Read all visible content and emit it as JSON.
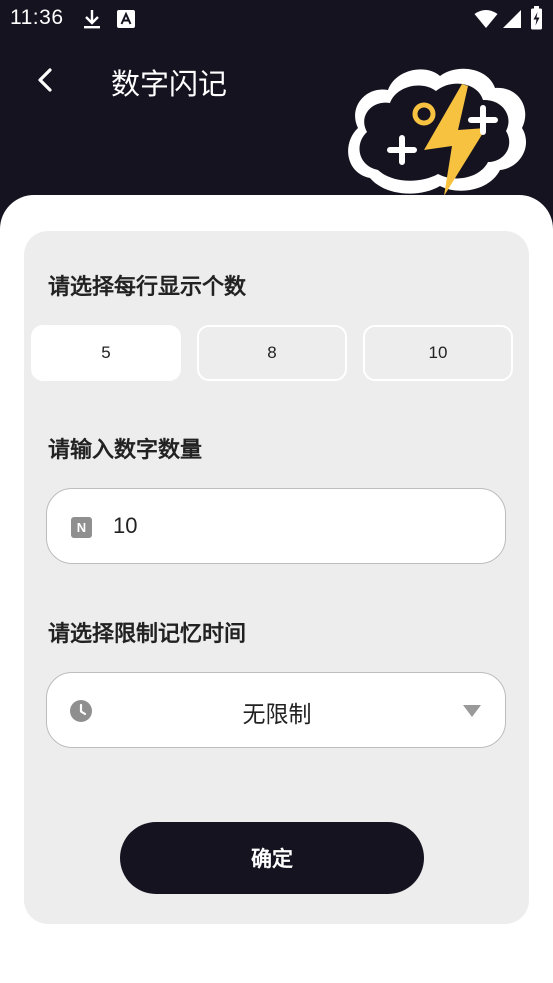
{
  "status_bar": {
    "time": "11:36",
    "icons": [
      "download-icon",
      "font-a-icon",
      "wifi-icon",
      "signal-icon",
      "battery-charging-icon"
    ]
  },
  "header": {
    "title": "数字闪记",
    "back_icon": "chevron-left-icon"
  },
  "per_row": {
    "label": "请选择每行显示个数",
    "options": [
      "5",
      "8",
      "10"
    ],
    "selected": "5"
  },
  "count": {
    "label": "请输入数字数量",
    "icon_letter": "N",
    "value": "10"
  },
  "time_limit": {
    "label": "请选择限制记忆时间",
    "value": "无限制"
  },
  "confirm_label": "确定",
  "colors": {
    "dark": "#151320",
    "card": "#ededed",
    "accent_yellow": "#f7c23f"
  }
}
